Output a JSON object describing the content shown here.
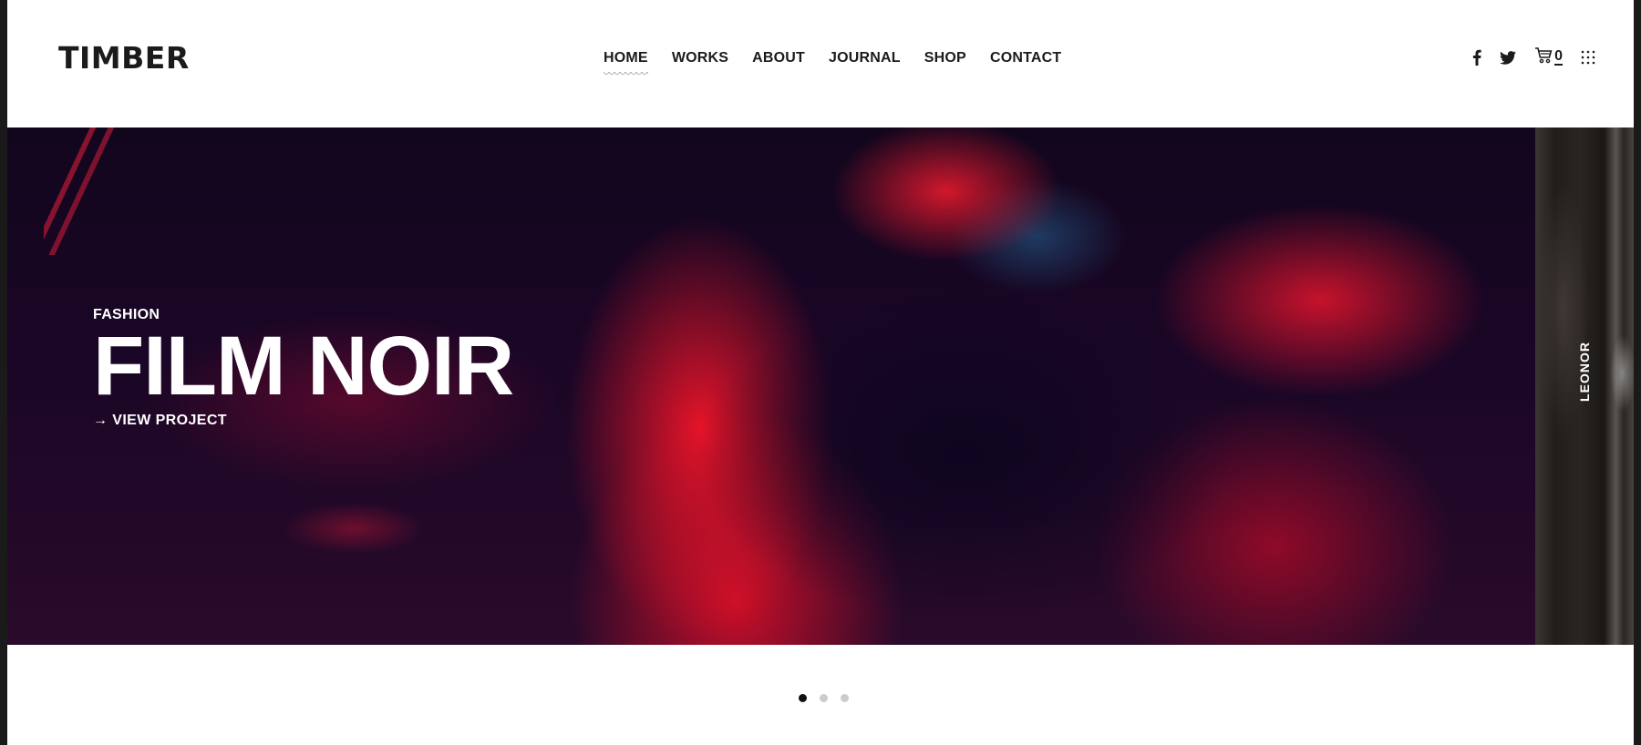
{
  "header": {
    "logo": "TIMBER",
    "nav": [
      {
        "label": "HOME",
        "active": true
      },
      {
        "label": "WORKS",
        "active": false
      },
      {
        "label": "ABOUT",
        "active": false
      },
      {
        "label": "JOURNAL",
        "active": false
      },
      {
        "label": "SHOP",
        "active": false
      },
      {
        "label": "CONTACT",
        "active": false
      }
    ],
    "tools": {
      "facebook_icon": "facebook-icon",
      "twitter_icon": "twitter-icon",
      "cart_icon": "cart-icon",
      "cart_count": "0",
      "menu_icon": "grid-menu-icon"
    }
  },
  "hero": {
    "category": "FASHION",
    "title": "FILM NOIR",
    "cta_arrow": "→",
    "cta_label": "VIEW PROJECT",
    "accent": "#e8132c"
  },
  "next_slide": {
    "label": "LEONOR"
  },
  "pagination": {
    "total": 3,
    "active_index": 0
  }
}
